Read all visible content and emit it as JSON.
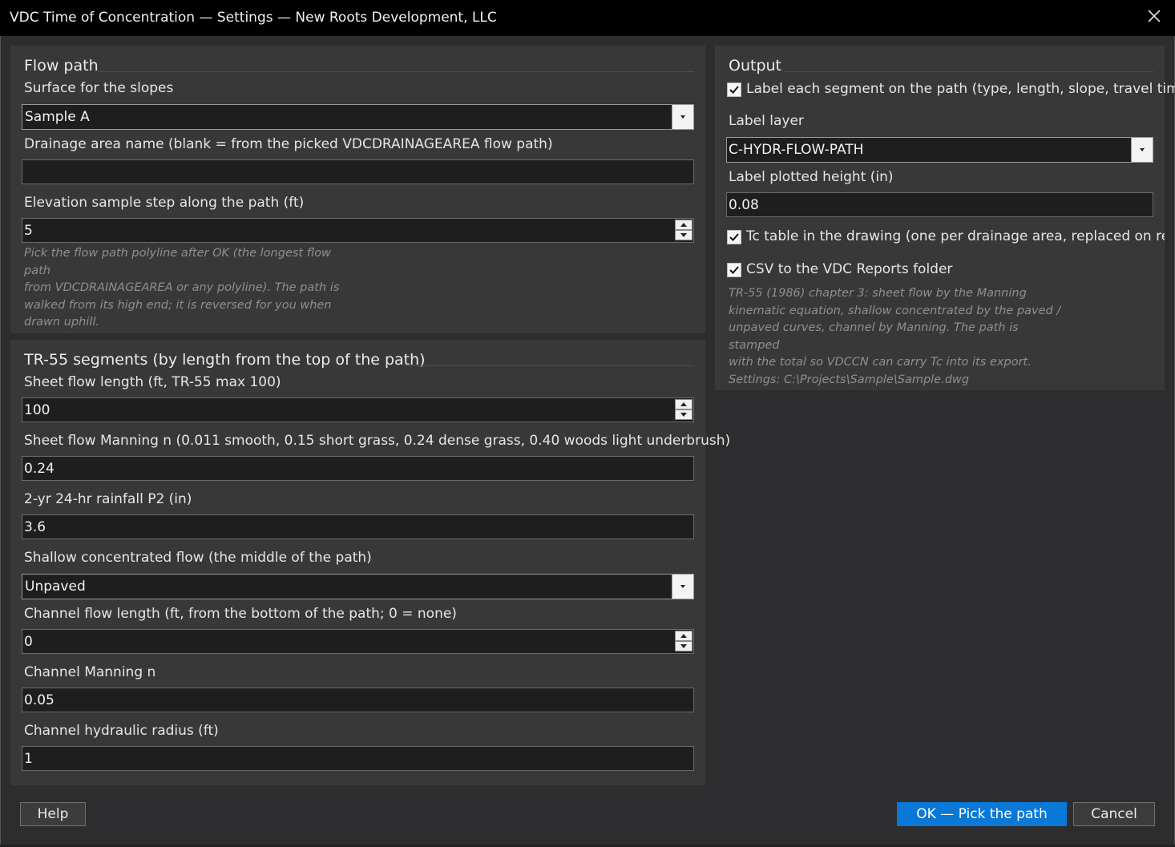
{
  "window": {
    "title": "VDC Time of Concentration — Settings — New Roots Development, LLC",
    "close_icon": "close-icon"
  },
  "flow_path": {
    "group_title": "Flow path",
    "surface_label": "Surface for the slopes",
    "surface_value": "Sample A",
    "drainage_label": "Drainage area name (blank = from the picked VDCDRAINAGEAREA flow path)",
    "drainage_value": "",
    "step_label": "Elevation sample step along the path (ft)",
    "step_value": "5",
    "note_lines": [
      "Pick the flow path polyline after OK (the longest flow path",
      "from VDCDRAINAGEAREA or any polyline). The path is",
      "walked from its high end; it is reversed for you when",
      "drawn uphill."
    ]
  },
  "segments": {
    "group_title": "TR-55 segments (by length from the top of the path)",
    "sheet_length_label": "Sheet flow length (ft, TR-55 max 100)",
    "sheet_length_value": "100",
    "sheet_n_label": "Sheet flow Manning n (0.011 smooth, 0.15 short grass, 0.24 dense grass, 0.40 woods light underbrush)",
    "sheet_n_value": "0.24",
    "rainfall_label": "2-yr 24-hr rainfall P2 (in)",
    "rainfall_value": "3.6",
    "shallow_label": "Shallow concentrated flow (the middle of the path)",
    "shallow_value": "Unpaved",
    "channel_length_label": "Channel flow length (ft, from the bottom of the path; 0 = none)",
    "channel_length_value": "0",
    "channel_n_label": "Channel Manning n",
    "channel_n_value": "0.05",
    "channel_radius_label": "Channel hydraulic radius (ft)",
    "channel_radius_value": "1"
  },
  "output": {
    "group_title": "Output",
    "label_segments_text": "Label each segment on the path (type, length, slope, travel time)",
    "label_segments_checked": true,
    "label_layer_label": "Label layer",
    "label_layer_value": "C-HYDR-FLOW-PATH",
    "label_height_label": "Label plotted height (in)",
    "label_height_value": "0.08",
    "tc_table_text": "Tc table in the drawing (one per drainage area, replaced on re-run",
    "tc_table_checked": true,
    "csv_text": "CSV to the VDC Reports folder",
    "csv_checked": true,
    "note_lines": [
      "TR-55 (1986) chapter 3: sheet flow by the Manning",
      "kinematic equation, shallow concentrated by the paved /",
      "unpaved curves, channel by Manning. The path is stamped",
      "with the total so VDCCN can carry Tc into its export.",
      "Settings: C:\\Projects\\Sample\\Sample.dwg"
    ]
  },
  "buttons": {
    "help": "Help",
    "ok": "OK — Pick the path",
    "cancel": "Cancel"
  },
  "colors": {
    "primary_button": "#0a78d7",
    "background": "#2d2d30",
    "panel": "#383838",
    "field": "#1e1e1e"
  }
}
